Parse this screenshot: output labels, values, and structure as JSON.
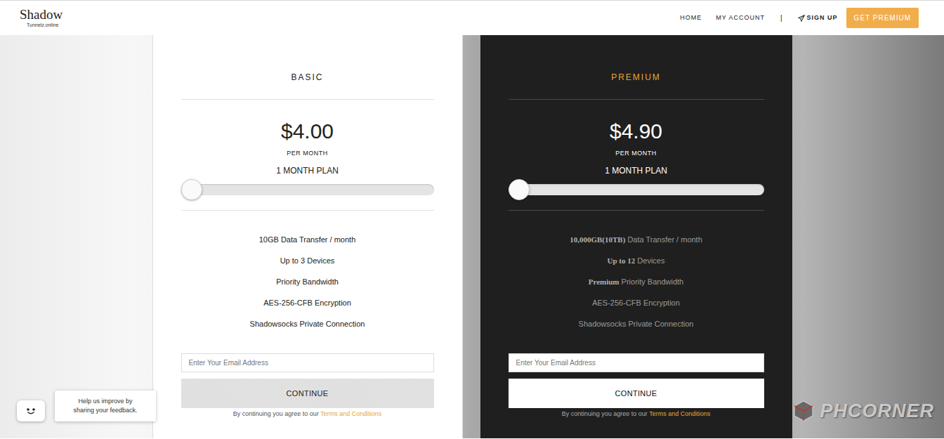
{
  "site": {
    "logo": "Shadow",
    "tagline": "Tunnelz.online"
  },
  "nav": {
    "links": [
      {
        "label": "HOME"
      },
      {
        "label": "MY ACCOUNT"
      }
    ],
    "separator": "|",
    "signup": "SIGN UP",
    "cta": "GET PREMIUM"
  },
  "plans": [
    {
      "kind": "basic",
      "name": "BASIC",
      "price": "$4.00",
      "period": "PER MONTH",
      "term": "1 MONTH PLAN",
      "level": 0,
      "features": [
        {
          "text": "10GB Data Transfer / month"
        },
        {
          "text": "Up to 3 Devices"
        },
        {
          "text": "Priority Bandwidth"
        },
        {
          "text": "AES-256-CFB Encryption"
        },
        {
          "text": "Shadowsocks Private Connection"
        }
      ],
      "email_placeholder": "Enter Your Email Address",
      "button": "CONTINUE",
      "terms_prefix": "By continuing you agree to our ",
      "terms_link": "Terms and Conditions"
    },
    {
      "kind": "premium",
      "name": "PREMIUM",
      "price": "$4.90",
      "period": "PER MONTH",
      "term": "1 MONTH PLAN",
      "level": 0,
      "features": [
        {
          "bold": "10,000GB(10TB)",
          "text": " Data Transfer / month"
        },
        {
          "bold": "Up to 12",
          "text": " Devices"
        },
        {
          "bold": "Premium",
          "text": " Priority Bandwidth"
        },
        {
          "text": "AES-256-CFB Encryption"
        },
        {
          "text": "Shadowsocks Private Connection"
        }
      ],
      "email_placeholder": "Enter Your Email Address",
      "button": "CONTINUE",
      "terms_prefix": "By continuing you agree to our ",
      "terms_link": "Terms and Conditions"
    }
  ],
  "feedback": "Help us improve by sharing your feedback.",
  "watermark": "PHCORNER"
}
